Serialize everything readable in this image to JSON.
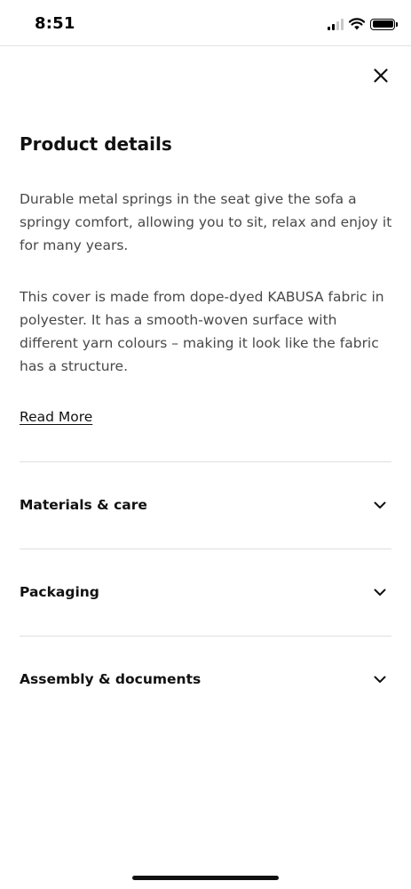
{
  "status_bar": {
    "time": "8:51",
    "icons": [
      "cellular-signal-icon",
      "wifi-icon",
      "battery-icon"
    ]
  },
  "modal": {
    "close_icon": "close-icon",
    "title": "Product details",
    "paragraphs": [
      "Durable metal springs in the seat give the sofa a springy comfort, allowing you to sit, relax and enjoy it for many years.",
      "This cover is made from dope-dyed KABUSA fabric in polyester. It has a smooth-woven surface with different yarn colours – making it look like the fabric has a structure."
    ],
    "read_more": "Read More",
    "sections": [
      {
        "label": "Materials & care",
        "icon": "chevron-down-icon"
      },
      {
        "label": "Packaging",
        "icon": "chevron-down-icon"
      },
      {
        "label": "Assembly & documents",
        "icon": "chevron-down-icon"
      }
    ]
  },
  "colors": {
    "text_primary": "#111111",
    "text_body": "#484848",
    "divider": "#dfdfdf",
    "background": "#ffffff"
  }
}
